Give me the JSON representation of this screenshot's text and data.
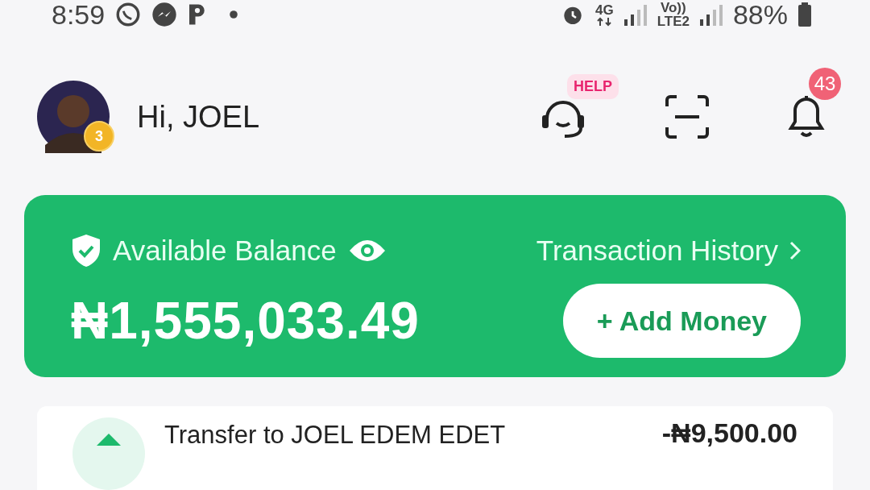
{
  "status_bar": {
    "time": "8:59",
    "network": "4G",
    "volte": "Vo))",
    "lte": "LTE2",
    "battery": "88%"
  },
  "header": {
    "greeting": "Hi, JOEL",
    "avatar_badge": "3",
    "help_label": "HELP",
    "notification_count": "43"
  },
  "balance_card": {
    "label": "Available Balance",
    "history_link": "Transaction History",
    "amount": "₦1,555,033.49",
    "add_button": "+ Add Money"
  },
  "transactions": [
    {
      "title": "Transfer to JOEL EDEM EDET",
      "amount": "-₦9,500.00"
    }
  ]
}
